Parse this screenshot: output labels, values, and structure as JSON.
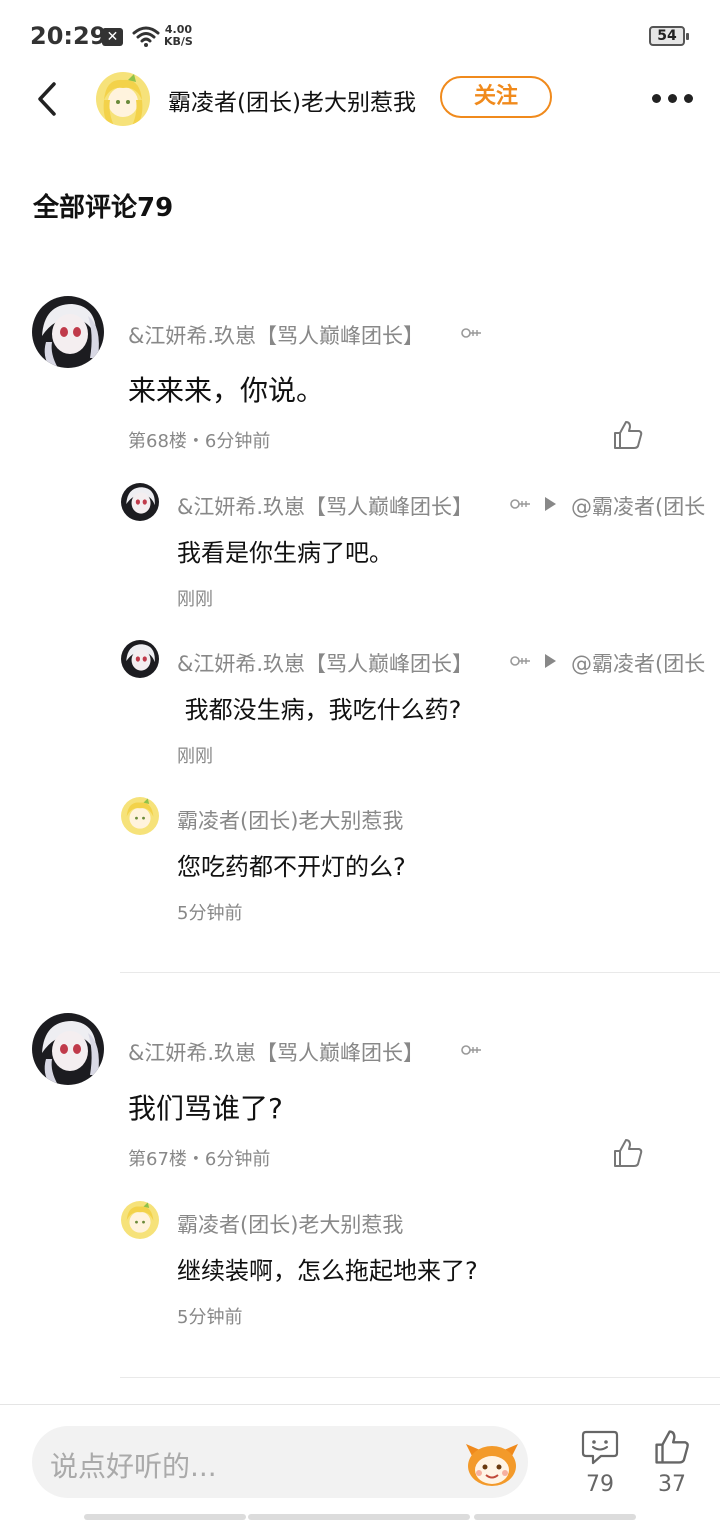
{
  "status_bar": {
    "time": "20:29",
    "sim_label": "✕",
    "net_speed_value": "4.00",
    "net_speed_unit": "KB/S",
    "battery": "54"
  },
  "header": {
    "user_name": "霸凌者(团长)老大别惹我",
    "follow_label": "关注"
  },
  "section_title": "全部评论79",
  "comments": [
    {
      "author": "&江妍希.玖崽【骂人巅峰团长】",
      "text": "来来来，你说。",
      "meta": "第68楼・6分钟前",
      "replies": [
        {
          "author": "&江妍希.玖崽【骂人巅峰团长】",
          "reply_to": "@霸凌者(团长",
          "text": "我看是你生病了吧。",
          "time": "刚刚"
        },
        {
          "author": "&江妍希.玖崽【骂人巅峰团长】",
          "reply_to": "@霸凌者(团长",
          "text": " 我都没生病，我吃什么药?",
          "time": "刚刚"
        },
        {
          "author": "霸凌者(团长)老大别惹我",
          "text": "您吃药都不开灯的么?",
          "time": "5分钟前"
        }
      ]
    },
    {
      "author": "&江妍希.玖崽【骂人巅峰团长】",
      "text": "我们骂谁了?",
      "meta": "第67楼・6分钟前",
      "replies": [
        {
          "author": "霸凌者(团长)老大别惹我",
          "text": "继续装啊，怎么拖起地来了?",
          "time": "5分钟前"
        }
      ]
    }
  ],
  "bottom_bar": {
    "input_placeholder": "说点好听的...",
    "comment_count": "79",
    "like_count": "37"
  },
  "colors": {
    "accent": "#f08a1c",
    "muted_text": "#888888",
    "body_text": "#111111"
  },
  "icons": {
    "back": "chevron-left-icon",
    "more": "more-dots-icon",
    "like": "thumbs-up-icon",
    "comment": "comment-bubble-icon",
    "emoji": "emoji-sticker-icon",
    "reply_arrow": "play-triangle-icon",
    "badge": "level-badge-icon"
  }
}
